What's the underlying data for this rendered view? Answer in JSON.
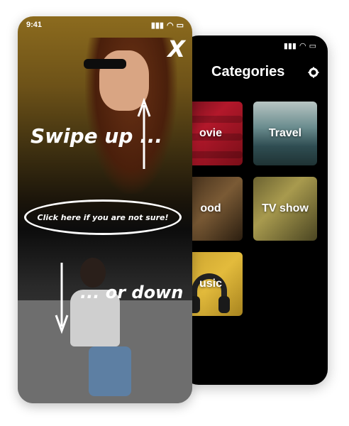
{
  "front": {
    "status_time": "9:41",
    "close_label": "X",
    "swipe_up_text": "Swipe up ...",
    "or_down_text": "... or down",
    "not_sure_text": "Click here if you are not sure!"
  },
  "back": {
    "title": "Categories",
    "tiles": [
      {
        "label": "Movie",
        "visible_label": "ovie"
      },
      {
        "label": "Travel",
        "visible_label": "Travel"
      },
      {
        "label": "Food",
        "visible_label": "ood"
      },
      {
        "label": "TV show",
        "visible_label": "TV show"
      },
      {
        "label": "Music",
        "visible_label": "usic"
      }
    ]
  },
  "colors": {
    "accent_gold": "#8c6b1e",
    "back_background": "#000000",
    "text": "#ffffff"
  }
}
